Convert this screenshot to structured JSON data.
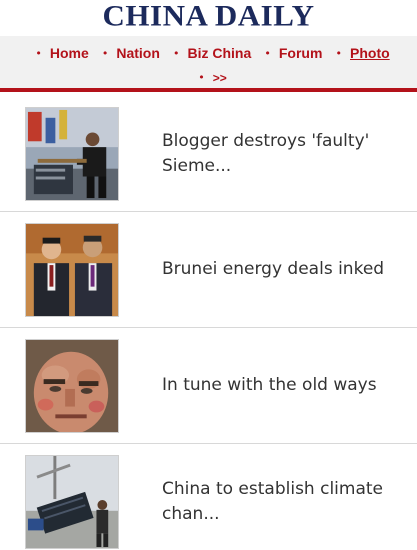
{
  "header": {
    "logo_text": "CHINA DAILY"
  },
  "nav": {
    "items": [
      {
        "label": "Home"
      },
      {
        "label": "Nation"
      },
      {
        "label": "Biz China"
      },
      {
        "label": "Forum"
      },
      {
        "label": "Photo"
      }
    ],
    "more_label": ">>",
    "bullet": "•",
    "accent_color": "#b3121a"
  },
  "articles": [
    {
      "headline": "Blogger destroys 'faulty' Sieme..."
    },
    {
      "headline": "Brunei energy deals inked"
    },
    {
      "headline": "In tune with the old ways"
    },
    {
      "headline": "China to establish climate chan..."
    }
  ]
}
